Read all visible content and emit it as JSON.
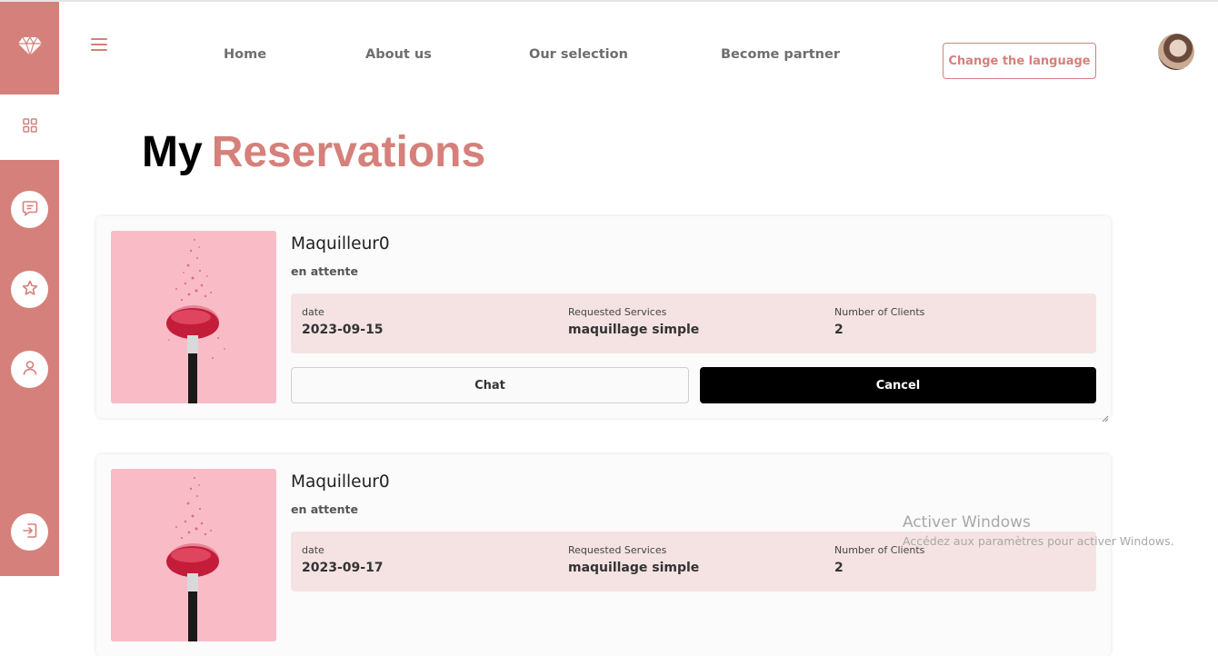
{
  "sidebar": {
    "logo_icon": "diamond-icon",
    "items": [
      {
        "name": "dashboard",
        "icon": "grid-icon",
        "active": true
      },
      {
        "name": "messages",
        "icon": "message-icon",
        "active": false
      },
      {
        "name": "favorites",
        "icon": "star-icon",
        "active": false
      },
      {
        "name": "profile",
        "icon": "user-icon",
        "active": false
      }
    ],
    "logout_icon": "logout-icon"
  },
  "header": {
    "menu_icon": "hamburger-icon",
    "nav": {
      "home": "Home",
      "about": "About us",
      "selection": "Our selection",
      "partner": "Become partner"
    },
    "language_button": "Change the language",
    "avatar_icon": "user-avatar"
  },
  "page": {
    "title_part1": "My",
    "title_part2": "Reservations"
  },
  "reservations": [
    {
      "name": "Maquilleur0",
      "status": "en attente",
      "date_label": "date",
      "date": "2023-09-15",
      "services_label": "Requested Services",
      "services": "maquillage simple",
      "clients_label": "Number of Clients",
      "clients": "2",
      "chat_label": "Chat",
      "cancel_label": "Cancel"
    },
    {
      "name": "Maquilleur0",
      "status": "en attente",
      "date_label": "date",
      "date": "2023-09-17",
      "services_label": "Requested Services",
      "services": "maquillage simple",
      "clients_label": "Number of Clients",
      "clients": "2"
    }
  ],
  "watermark": {
    "line1": "Activer Windows",
    "line2": "Accédez aux paramètres pour activer Windows."
  },
  "colors": {
    "accent": "#d5807a",
    "info_bg": "#f5e3e3",
    "cancel_bg": "#000000"
  }
}
